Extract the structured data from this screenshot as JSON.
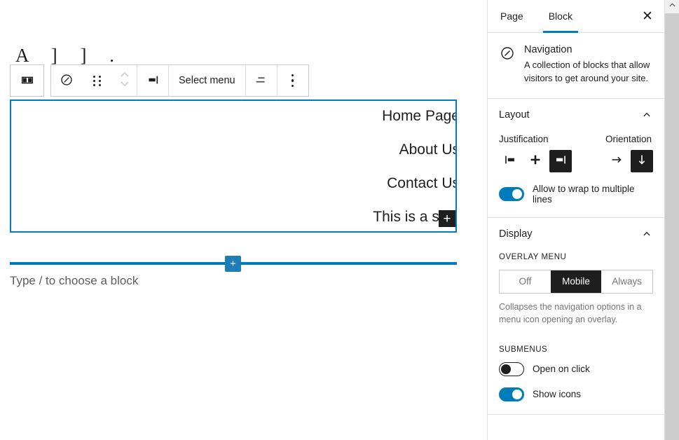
{
  "editor": {
    "glyph_fragments": "A ] ] . ]",
    "toolbar": {
      "sidebar_toggle_icon": "columns-icon",
      "block_type_icon": "navigation-compass-icon",
      "drag_handle_icon": "drag-handle-icon",
      "movers_icon": "move-up-down-icon",
      "justify_icon": "justify-right-icon",
      "select_menu_label": "Select menu",
      "align_icon": "align-text-icon",
      "options_icon": "more-options-icon"
    },
    "navigation_block": {
      "items": [
        "Home Page",
        "About Us",
        "Contact Us",
        "This is a sam"
      ],
      "appender_label": "+"
    },
    "inserter": {
      "plus_label": "+"
    },
    "placeholder": "Type / to choose a block"
  },
  "sidebar": {
    "tabs": [
      {
        "label": "Page",
        "active": false
      },
      {
        "label": "Block",
        "active": true
      }
    ],
    "close_label": "✕",
    "block_card": {
      "icon": "navigation-compass-icon",
      "title": "Navigation",
      "description": "A collection of blocks that allow visitors to get around your site."
    },
    "layout": {
      "title": "Layout",
      "collapse_icon": "chevron-up-icon",
      "justification": {
        "label": "Justification",
        "options": [
          {
            "icon": "justify-left-icon",
            "selected": false
          },
          {
            "icon": "justify-center-icon",
            "selected": false
          },
          {
            "icon": "justify-right-icon",
            "selected": true
          }
        ]
      },
      "orientation": {
        "label": "Orientation",
        "options": [
          {
            "icon": "arrow-right-icon",
            "selected": false
          },
          {
            "icon": "arrow-down-icon",
            "selected": true
          }
        ]
      },
      "wrap_toggle": {
        "label": "Allow to wrap to multiple lines",
        "on": true
      }
    },
    "display": {
      "title": "Display",
      "collapse_icon": "chevron-up-icon",
      "overlay_menu": {
        "label": "OVERLAY MENU",
        "options": [
          {
            "label": "Off",
            "selected": false
          },
          {
            "label": "Mobile",
            "selected": true
          },
          {
            "label": "Always",
            "selected": false
          }
        ],
        "help": "Collapses the navigation options in a menu icon opening an overlay."
      },
      "submenus": {
        "label": "SUBMENUS",
        "toggles": [
          {
            "label": "Open on click",
            "on": false
          },
          {
            "label": "Show icons",
            "on": true
          }
        ]
      }
    }
  },
  "scrollbar": {
    "up_arrow_icon": "chevron-up-icon"
  },
  "colors": {
    "accent": "#007cba",
    "selected_bg": "#1e1e1e",
    "text": "#1e1e1e",
    "muted": "#757575"
  }
}
